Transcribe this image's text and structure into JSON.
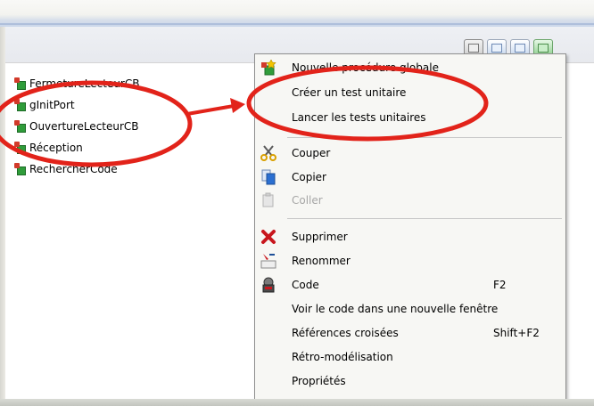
{
  "tree": {
    "items": [
      {
        "label": "FermetureLecteurCB"
      },
      {
        "label": "gInitPort"
      },
      {
        "label": "OuvertureLecteurCB"
      },
      {
        "label": "Réception"
      },
      {
        "label": "RechercherCode"
      }
    ]
  },
  "context_menu": {
    "items": [
      {
        "label": "Nouvelle procédure globale",
        "icon": "new-procedure-icon"
      },
      {
        "label": "Créer un test unitaire"
      },
      {
        "label": "Lancer les tests unitaires"
      },
      {
        "label": "Couper",
        "icon": "scissors-icon"
      },
      {
        "label": "Copier",
        "icon": "copy-icon"
      },
      {
        "label": "Coller",
        "icon": "paste-icon",
        "disabled": true
      },
      {
        "label": "Supprimer",
        "icon": "delete-icon"
      },
      {
        "label": "Renommer",
        "icon": "rename-icon"
      },
      {
        "label": "Code",
        "shortcut": "F2",
        "icon": "code-icon"
      },
      {
        "label": "Voir le code dans une nouvelle fenêtre"
      },
      {
        "label": "Références croisées",
        "shortcut": "Shift+F2"
      },
      {
        "label": "Rétro-modélisation"
      },
      {
        "label": "Propriétés"
      }
    ]
  },
  "colors": {
    "annotation_red": "#e2231a",
    "tree_icon_green": "#2f9c3a",
    "tree_icon_red": "#d23a2a"
  }
}
